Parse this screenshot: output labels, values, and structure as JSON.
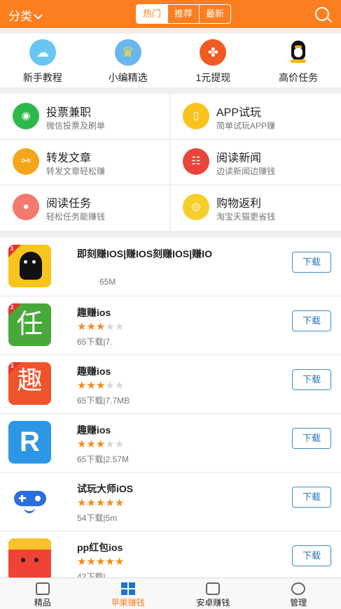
{
  "header": {
    "category_label": "分类",
    "tabs": [
      "热门",
      "推荐",
      "最新"
    ]
  },
  "quicknav": [
    {
      "label": "新手教程",
      "icon": "tutorial-icon",
      "color": "#69c5f1"
    },
    {
      "label": "小编精选",
      "icon": "crown-icon",
      "color": "#6ab7ee"
    },
    {
      "label": "1元提现",
      "icon": "pinwheel-icon",
      "color": "#f05a23"
    },
    {
      "label": "高价任务",
      "icon": "penguin-icon",
      "color": "#111111"
    }
  ],
  "tasks": [
    {
      "title": "投票兼职",
      "subtitle": "微信投票及刷单",
      "icon": "wechat-icon"
    },
    {
      "title": "APP试玩",
      "subtitle": "简单试玩APP赚",
      "icon": "phone-icon"
    },
    {
      "title": "转发文章",
      "subtitle": "转发文章轻松赚",
      "icon": "share-icon"
    },
    {
      "title": "阅读新闻",
      "subtitle": "边读新闻边赚钱",
      "icon": "news-icon"
    },
    {
      "title": "阅读任务",
      "subtitle": "轻松任务能赚钱",
      "icon": "piggy-bank-icon"
    },
    {
      "title": "购物返利",
      "subtitle": "淘宝天猫更省钱",
      "icon": "coin-icon"
    }
  ],
  "apps": [
    {
      "name": "即刻赚IOS|赚IOS刻赚IOS|赚IO",
      "rating": 0,
      "meta": "65M",
      "button": "下载",
      "logo_color": "#f7c51e",
      "badge": "1"
    },
    {
      "name": "趣赚ios",
      "rating": 3,
      "meta": "65下载|7.",
      "button": "下载",
      "logo_color": "#49a83b",
      "badge": "2",
      "logo_text": "任"
    },
    {
      "name": "趣赚ios",
      "rating": 3,
      "meta": "65下载|7.7MB",
      "button": "下载",
      "logo_color": "#f0542a",
      "badge": "3",
      "logo_text": "趣"
    },
    {
      "name": "趣赚ios",
      "rating": 3,
      "meta": "65下载|2.57M",
      "button": "下载",
      "logo_color": "#2d97e6",
      "badge": "",
      "logo_text": "R"
    },
    {
      "name": "试玩大师iOS",
      "rating": 5,
      "meta": "54下载|5m",
      "button": "下载",
      "logo_color": "#ffffff",
      "badge": ""
    },
    {
      "name": "pp红包ios",
      "rating": 5,
      "meta": "42下载|",
      "button": "下载",
      "logo_color": "#ef4337",
      "badge": ""
    }
  ],
  "tabbar": [
    {
      "label": "精品",
      "icon": "thumbs-up-icon",
      "active": false
    },
    {
      "label": "苹果赚钱",
      "icon": "grid-icon",
      "active": true
    },
    {
      "label": "安卓赚钱",
      "icon": "gamepad-icon",
      "active": false
    },
    {
      "label": "管理",
      "icon": "gear-icon",
      "active": false
    }
  ],
  "colors": {
    "accent": "#fd7e1f",
    "button_border": "#3c8dc8",
    "star": "#f58a17"
  }
}
